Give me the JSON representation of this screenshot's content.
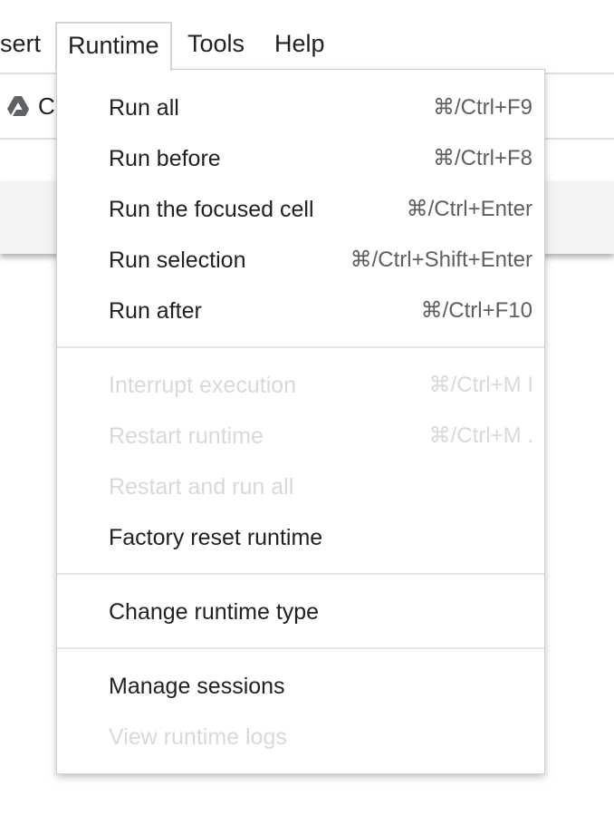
{
  "menubar": {
    "items": [
      {
        "label": "sert"
      },
      {
        "label": "Runtime"
      },
      {
        "label": "Tools"
      },
      {
        "label": "Help"
      }
    ]
  },
  "toolbar": {
    "drive_icon": "google-drive-icon",
    "text": "C"
  },
  "runtime_menu": {
    "items": [
      {
        "label": "Run all",
        "shortcut": "⌘/Ctrl+F9",
        "disabled": false
      },
      {
        "label": "Run before",
        "shortcut": "⌘/Ctrl+F8",
        "disabled": false
      },
      {
        "label": "Run the focused cell",
        "shortcut": "⌘/Ctrl+Enter",
        "disabled": false
      },
      {
        "label": "Run selection",
        "shortcut": "⌘/Ctrl+Shift+Enter",
        "disabled": false
      },
      {
        "label": "Run after",
        "shortcut": "⌘/Ctrl+F10",
        "disabled": false
      },
      {
        "label": "Interrupt execution",
        "shortcut": "⌘/Ctrl+M I",
        "disabled": true
      },
      {
        "label": "Restart runtime",
        "shortcut": "⌘/Ctrl+M .",
        "disabled": true
      },
      {
        "label": "Restart and run all",
        "shortcut": "",
        "disabled": true
      },
      {
        "label": "Factory reset runtime",
        "shortcut": "",
        "disabled": false
      },
      {
        "label": "Change runtime type",
        "shortcut": "",
        "disabled": false
      },
      {
        "label": "Manage sessions",
        "shortcut": "",
        "disabled": false
      },
      {
        "label": "View runtime logs",
        "shortcut": "",
        "disabled": true
      }
    ]
  }
}
